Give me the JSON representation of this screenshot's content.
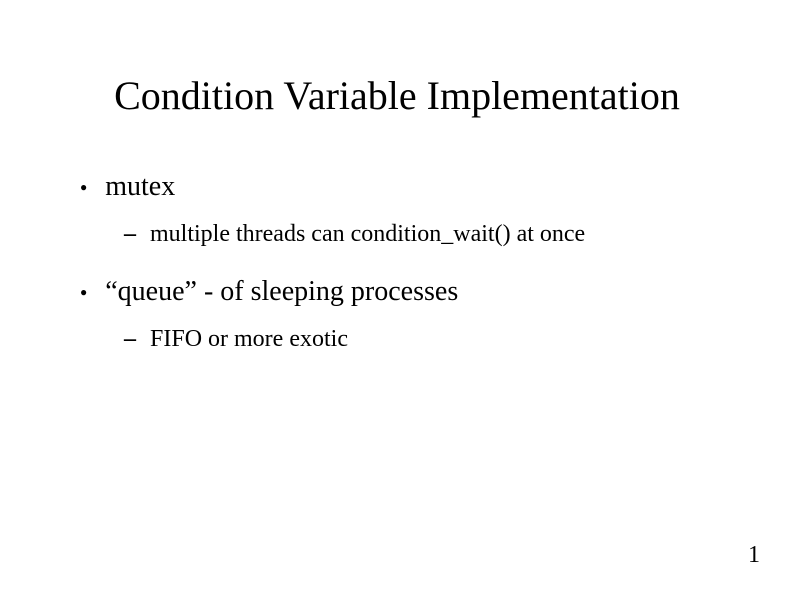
{
  "title": "Condition Variable Implementation",
  "bullets": [
    {
      "text": "mutex",
      "sub": [
        {
          "text": "multiple threads can condition_wait() at once"
        }
      ]
    },
    {
      "text": "“queue” - of sleeping processes",
      "sub": [
        {
          "text": "FIFO or more exotic"
        }
      ]
    }
  ],
  "pageNumber": "1"
}
